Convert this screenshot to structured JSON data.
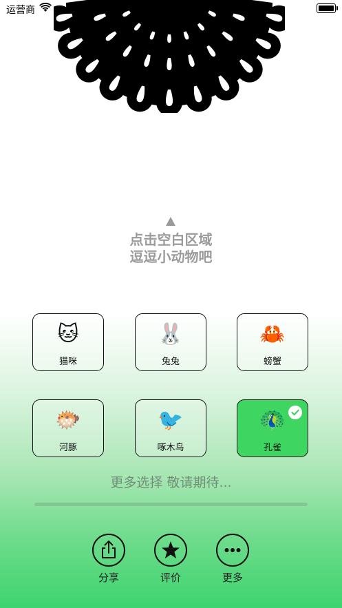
{
  "status_bar": {
    "carrier": "运营商"
  },
  "hint": {
    "line1": "点击空白区域",
    "line2": "逗逗小动物吧"
  },
  "animals": [
    {
      "emoji": "🐱",
      "label": "猫咪",
      "selected": false
    },
    {
      "emoji": "🐰",
      "label": "兔兔",
      "selected": false
    },
    {
      "emoji": "🦀",
      "label": "螃蟹",
      "selected": false
    },
    {
      "emoji": "🐡",
      "label": "河豚",
      "selected": false
    },
    {
      "emoji": "🐦",
      "label": "啄木鸟",
      "selected": false
    },
    {
      "emoji": "🦚",
      "label": "孔雀",
      "selected": true
    }
  ],
  "more_text": "更多选择 敬请期待...",
  "actions": [
    {
      "label": "分享",
      "icon": "share-icon"
    },
    {
      "label": "评价",
      "icon": "star-icon"
    },
    {
      "label": "更多",
      "icon": "more-icon"
    }
  ],
  "colors": {
    "selected_card": "#3ed561",
    "hint_text": "#9b9b9b",
    "gradient_bottom": "#3ed46f"
  }
}
